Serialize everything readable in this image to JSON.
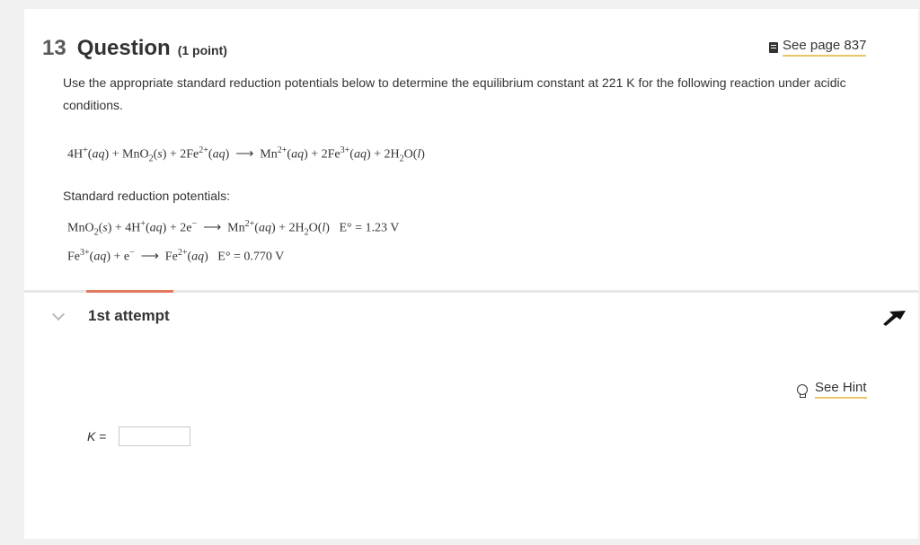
{
  "question": {
    "number": "13",
    "title": "Question",
    "points": "(1 point)",
    "see_page": "See page 837",
    "prompt": "Use the appropriate standard reduction potentials below to determine the equilibrium constant at 221 K for the following reaction under acidic conditions.",
    "standard_label": "Standard reduction potentials:",
    "half1_e": "E° = 1.23 V",
    "half2_e": "E° = 0.770 V"
  },
  "attempt": {
    "label": "1st attempt",
    "hint": "See Hint",
    "k_label": "K",
    "k_eq": " =",
    "k_value": ""
  },
  "colors": {
    "accent": "#e07a5f",
    "link_underline": "#e8c66a"
  }
}
